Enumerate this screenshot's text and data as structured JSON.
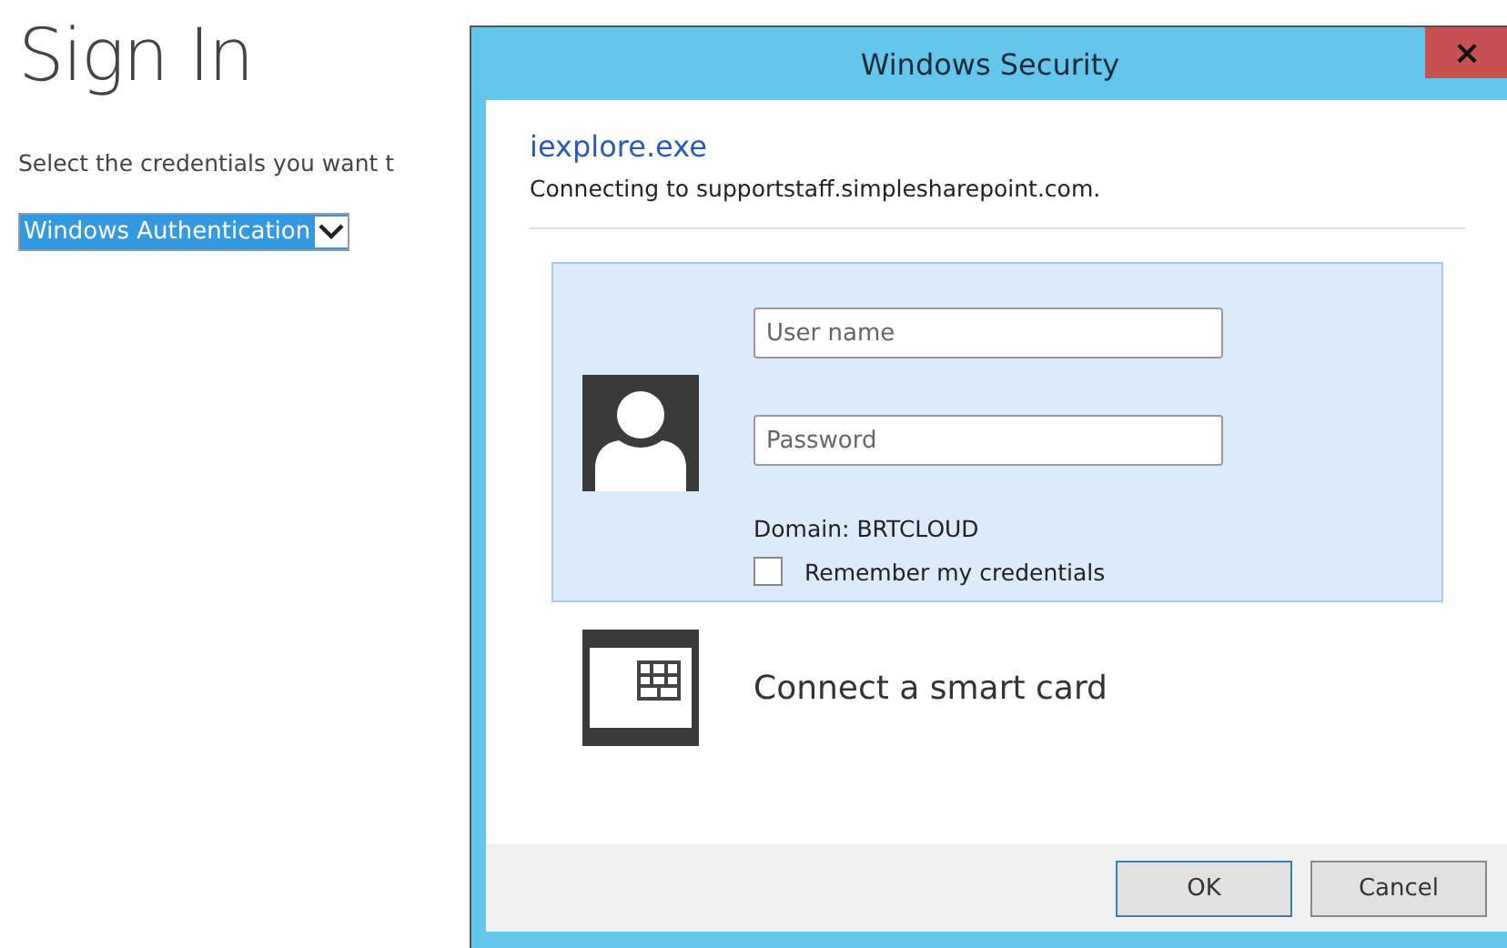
{
  "page": {
    "title": "Sign In",
    "prompt": "Select the credentials you want t",
    "auth_select": {
      "value": "Windows Authentication"
    }
  },
  "dialog": {
    "title": "Windows Security",
    "close_label": "×",
    "app": "iexplore.exe",
    "message": "Connecting to supportstaff.simplesharepoint.com.",
    "options": [
      {
        "kind": "credentials",
        "selected": true,
        "username_placeholder": "User name",
        "password_placeholder": "Password",
        "domain": "Domain: BRTCLOUD",
        "remember": {
          "label": "Remember my credentials",
          "checked": false
        }
      },
      {
        "kind": "smartcard",
        "selected": false,
        "label": "Connect a smart card"
      }
    ],
    "buttons": [
      "OK",
      "Cancel"
    ]
  }
}
